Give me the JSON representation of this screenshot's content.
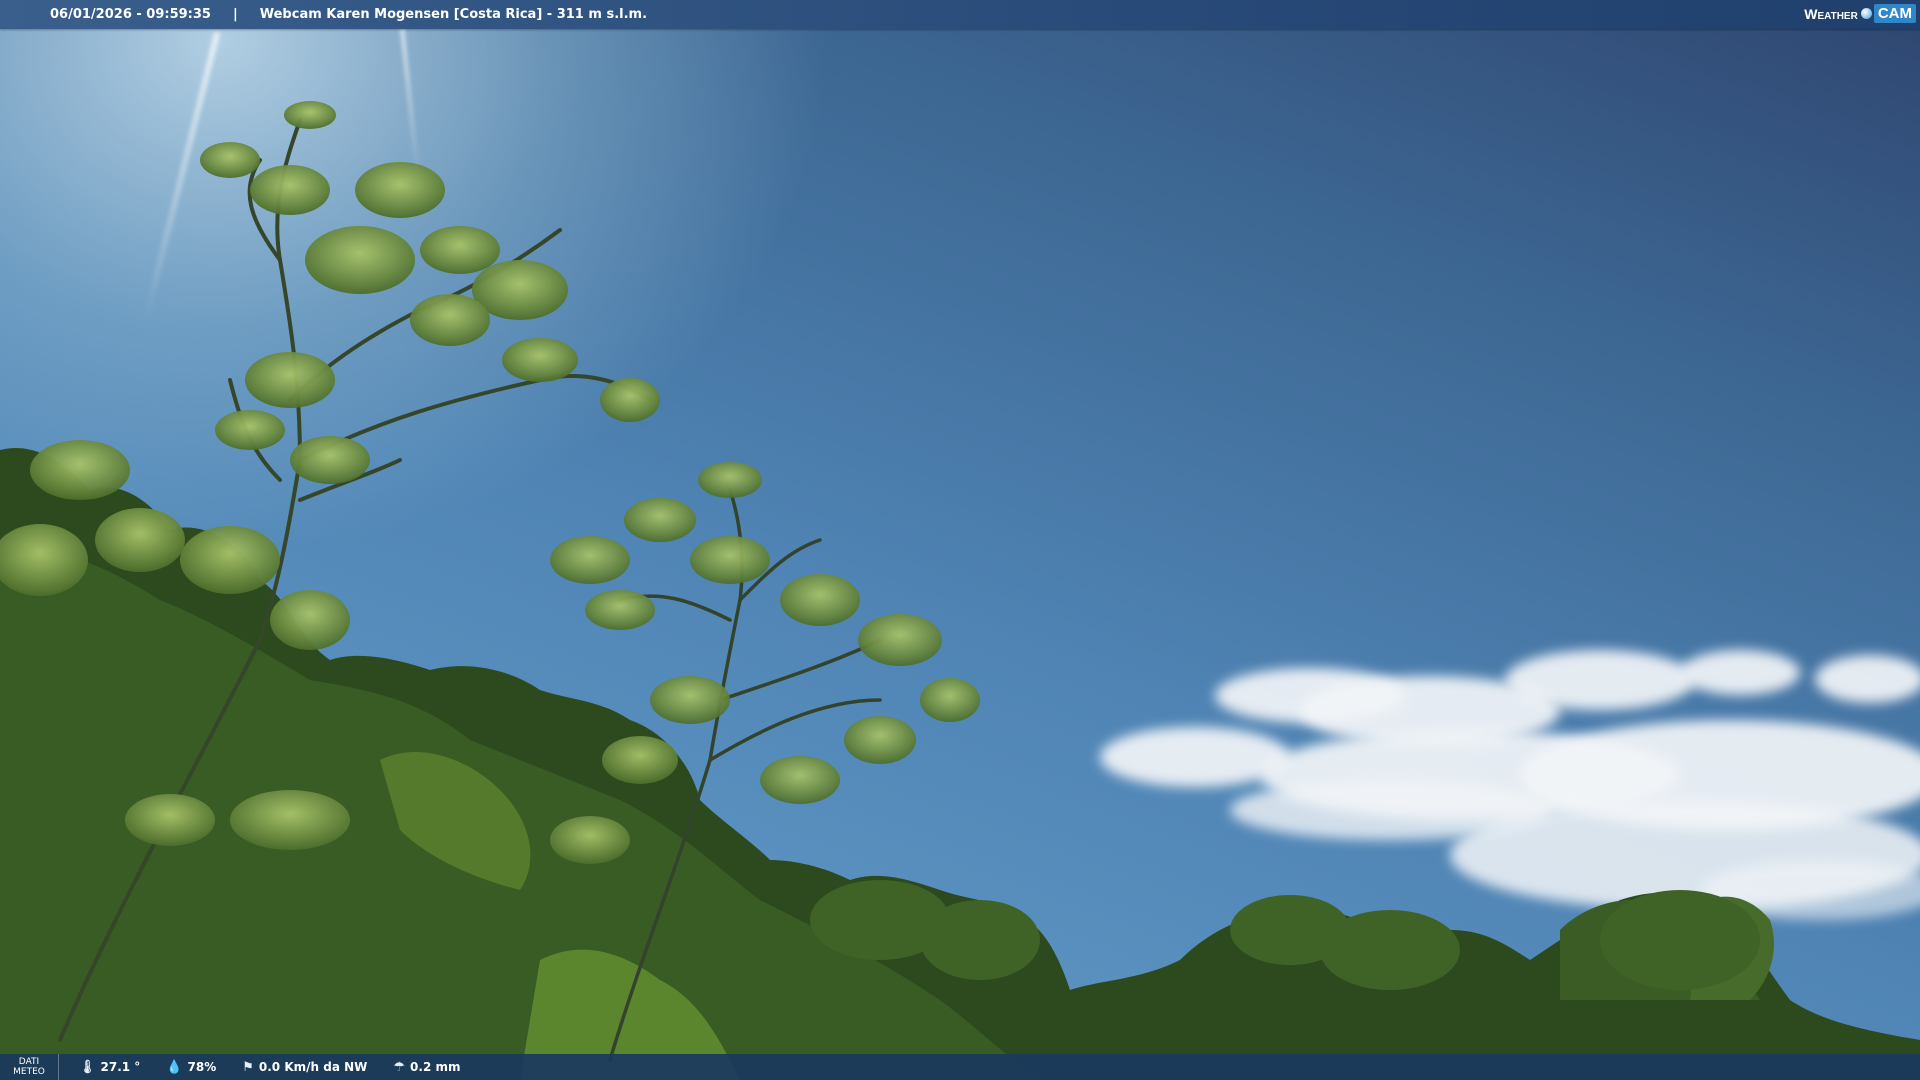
{
  "header": {
    "datetime": "06/01/2026 - 09:59:35",
    "separator": "|",
    "location": "Webcam Karen Mogensen [Costa Rica]  - 311 m s.l.m."
  },
  "brand": {
    "weather": "Weather",
    "cam": "CAM"
  },
  "meteo": {
    "label_line1": "DATI",
    "label_line2": "METEO",
    "temperature": "27.1 °",
    "humidity": "78%",
    "wind": "0.0 Km/h da NW",
    "rain": "0.2 mm"
  },
  "icons": {
    "temperature": "thermometer-icon",
    "humidity": "drop-icon",
    "wind": "windsock-icon",
    "rain": "umbrella-icon"
  }
}
